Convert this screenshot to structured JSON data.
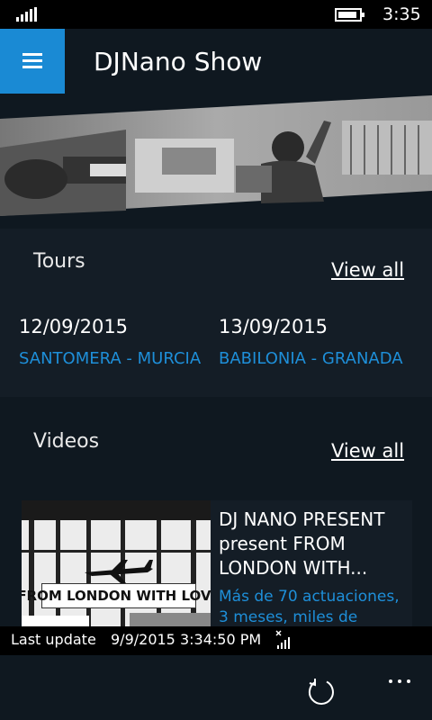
{
  "status_bar": {
    "time": "3:35",
    "icons": [
      "signal-icon",
      "battery-icon"
    ]
  },
  "header": {
    "title": "DJNano Show",
    "menu_icon": "hamburger-menu-icon"
  },
  "tours": {
    "heading": "Tours",
    "view_all": "View all",
    "items": [
      {
        "date": "12/09/2015",
        "place": "SANTOMERA - MURCIA"
      },
      {
        "date": "13/09/2015",
        "place": "BABILONIA - GRANADA"
      }
    ]
  },
  "videos": {
    "heading": "Videos",
    "view_all": "View all",
    "items": [
      {
        "title": "DJ NANO PRESENT present FROM LONDON WITH...",
        "description": "Más de 70 actuaciones, 3 meses, miles de",
        "thumb_text": "FROM LONDON WITH LOVE"
      }
    ]
  },
  "update": {
    "label": "Last update",
    "timestamp": "9/9/2015 3:34:50 PM"
  },
  "app_bar": {
    "icons": [
      "refresh-icon",
      "more-icon"
    ]
  },
  "colors": {
    "accent": "#1a8ad4",
    "link": "#1e8fd9",
    "background": "#0f1820",
    "section": "#141d26"
  }
}
